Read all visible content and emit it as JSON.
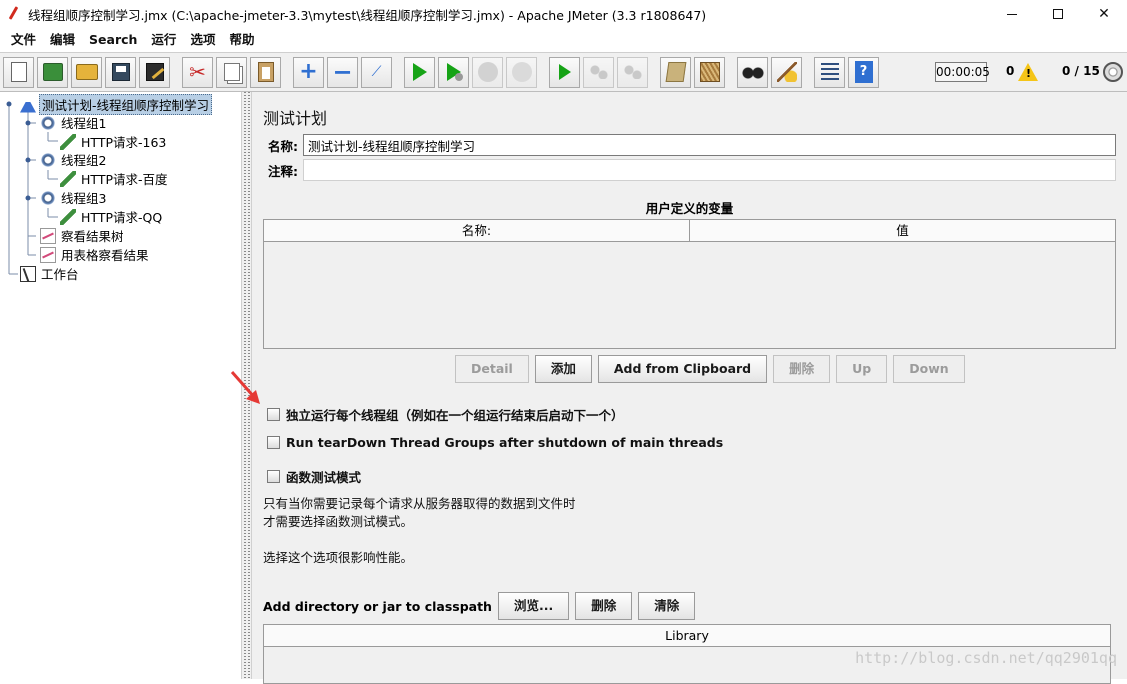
{
  "window": {
    "title": "线程组顺序控制学习.jmx (C:\\apache-jmeter-3.3\\mytest\\线程组顺序控制学习.jmx) - Apache JMeter (3.3 r1808647)",
    "minimize": "—",
    "maximize": "☐",
    "close": "✕"
  },
  "menu": [
    "文件",
    "编辑",
    "Search",
    "运行",
    "选项",
    "帮助"
  ],
  "toolbar": {
    "timer": "00:00:05",
    "warnings": "0",
    "threads": "0 / 15"
  },
  "tree": {
    "items": [
      {
        "label": "测试计划-线程组顺序控制学习",
        "icon": "flask-icon"
      },
      {
        "label": "线程组1",
        "icon": "gear-icon"
      },
      {
        "label": "HTTP请求-163",
        "icon": "pipette-icon"
      },
      {
        "label": "线程组2",
        "icon": "gear-icon"
      },
      {
        "label": "HTTP请求-百度",
        "icon": "pipette-icon"
      },
      {
        "label": "线程组3",
        "icon": "gear-icon"
      },
      {
        "label": "HTTP请求-QQ",
        "icon": "pipette-icon"
      },
      {
        "label": "察看结果树",
        "icon": "chart-icon"
      },
      {
        "label": "用表格察看结果",
        "icon": "chart-icon"
      },
      {
        "label": "工作台",
        "icon": "workbench-icon"
      }
    ]
  },
  "main": {
    "title": "测试计划",
    "name_label": "名称:",
    "name_value": "测试计划-线程组顺序控制学习",
    "comment_label": "注释:",
    "comment_value": "",
    "vars_title": "用户定义的变量",
    "vars_columns": [
      "名称:",
      "值"
    ],
    "buttons": {
      "detail": "Detail",
      "add": "添加",
      "add_clipboard": "Add from Clipboard",
      "delete": "删除",
      "up": "Up",
      "down": "Down"
    },
    "chk_serial": "独立运行每个线程组（例如在一个组运行结束后启动下一个）",
    "chk_teardown": "Run tearDown Thread Groups after shutdown of main threads",
    "chk_functional": "函数测试模式",
    "note_line1": "只有当你需要记录每个请求从服务器取得的数据到文件时",
    "note_line2": "才需要选择函数测试模式。",
    "note_line3": "选择这个选项很影响性能。",
    "classpath_label": "Add directory or jar to classpath",
    "cp_browse": "浏览...",
    "cp_delete": "删除",
    "cp_clear": "清除",
    "library_header": "Library"
  },
  "watermark": "http://blog.csdn.net/qq2901qq",
  "colors": {
    "accent": "#2f6fd1",
    "arrow": "#e53935",
    "selection": "#b8cfe5"
  }
}
